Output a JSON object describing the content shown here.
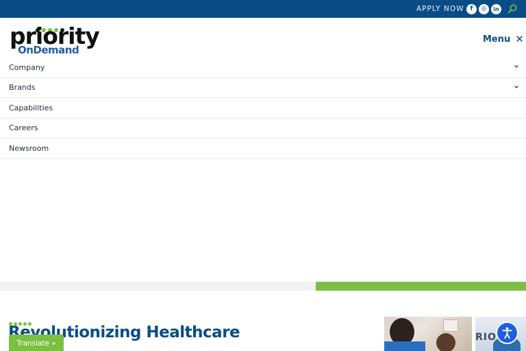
{
  "topbar": {
    "apply_now": "APPLY NOW",
    "social": [
      {
        "icon": "facebook-icon",
        "glyph": "f"
      },
      {
        "icon": "instagram-icon",
        "glyph": "◎"
      },
      {
        "icon": "linkedin-icon",
        "glyph": "in"
      }
    ],
    "search_icon": "search-icon",
    "background": "#0a4d86"
  },
  "header": {
    "logo": {
      "word1": "priority",
      "word2": "OnDemand",
      "dot_colors": [
        "#111111",
        "#7bc043",
        "#7bc043",
        "#7bc043",
        "#111111"
      ]
    },
    "menu_label": "Menu",
    "menu_close_glyph": "✕"
  },
  "nav": {
    "items": [
      {
        "label": "Company",
        "has_submenu": true
      },
      {
        "label": "Brands",
        "has_submenu": true
      },
      {
        "label": "Capabilities",
        "has_submenu": false
      },
      {
        "label": "Careers",
        "has_submenu": false
      },
      {
        "label": "Newsroom",
        "has_submenu": false
      }
    ]
  },
  "progress": {
    "fraction": 0.6
  },
  "hero": {
    "title": "Revolutionizing Healthcare",
    "accent_color": "#7bc043",
    "title_color": "#0a4d86"
  },
  "photos": {
    "second_sign_text": "RIOR"
  },
  "widgets": {
    "translate_label": "Translate »",
    "accessibility_icon": "accessibility-icon"
  }
}
